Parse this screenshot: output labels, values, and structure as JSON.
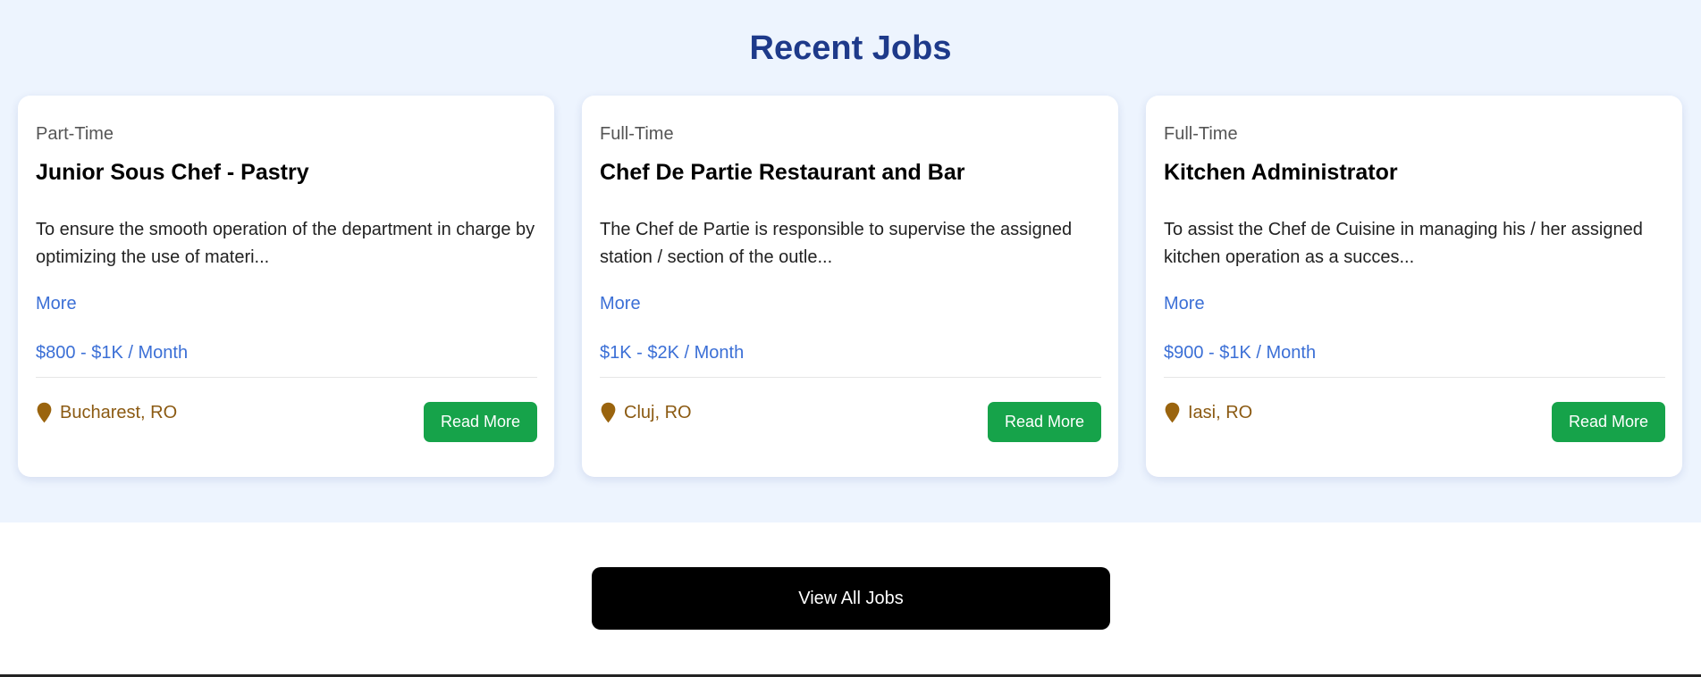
{
  "section": {
    "title": "Recent Jobs"
  },
  "jobs": [
    {
      "type": "Part-Time",
      "title": "Junior Sous Chef - Pastry",
      "description": "To ensure the smooth operation of the department in charge by optimizing the use of materi...",
      "more_label": "More",
      "salary": "$800 - $1K / Month",
      "location": "Bucharest, RO",
      "button_label": "Read More"
    },
    {
      "type": "Full-Time",
      "title": "Chef De Partie Restaurant and Bar",
      "description": "The Chef de Partie is responsible to supervise the assigned station / section of the outle...",
      "more_label": "More",
      "salary": "$1K - $2K / Month",
      "location": "Cluj, RO",
      "button_label": "Read More"
    },
    {
      "type": "Full-Time",
      "title": "Kitchen Administrator",
      "description": "To assist the Chef de Cuisine in managing his / her assigned kitchen operation as a succes...",
      "more_label": "More",
      "salary": "$900 - $1K / Month",
      "location": "Iasi, RO",
      "button_label": "Read More"
    }
  ],
  "footer": {
    "view_all_label": "View All Jobs"
  },
  "colors": {
    "section_bg": "#edf4fe",
    "title": "#1e3a8a",
    "link": "#3b6fd6",
    "location": "#8b5a12",
    "button": "#16a34a",
    "view_all_bg": "#000000"
  },
  "icons": {
    "location": "map-pin-icon"
  }
}
